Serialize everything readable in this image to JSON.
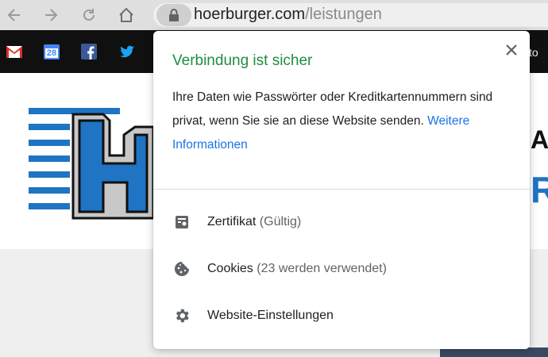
{
  "browser": {
    "url_host": "hoerburger.com",
    "url_path": "/leistungen"
  },
  "bookmarks": {
    "calendar_day": "28",
    "trailing_label": "to"
  },
  "page": {
    "right_text_1": "AU",
    "right_text_2": "R"
  },
  "security_popup": {
    "title": "Verbindung ist sicher",
    "description": "Ihre Daten wie Passwörter oder Kreditkartennummern sind privat, wenn Sie sie an diese Website senden.",
    "more_info_link": "Weitere Informationen",
    "items": [
      {
        "label": "Zertifikat",
        "detail": "(Gültig)",
        "icon": "certificate-icon"
      },
      {
        "label": "Cookies",
        "detail": "(23 werden verwendet)",
        "icon": "cookie-icon"
      },
      {
        "label": "Website-Einstellungen",
        "detail": "",
        "icon": "gear-icon"
      }
    ]
  },
  "colors": {
    "secure_title": "#1e8e3e",
    "link": "#1a73e8",
    "brand_blue": "#1f74c4"
  }
}
